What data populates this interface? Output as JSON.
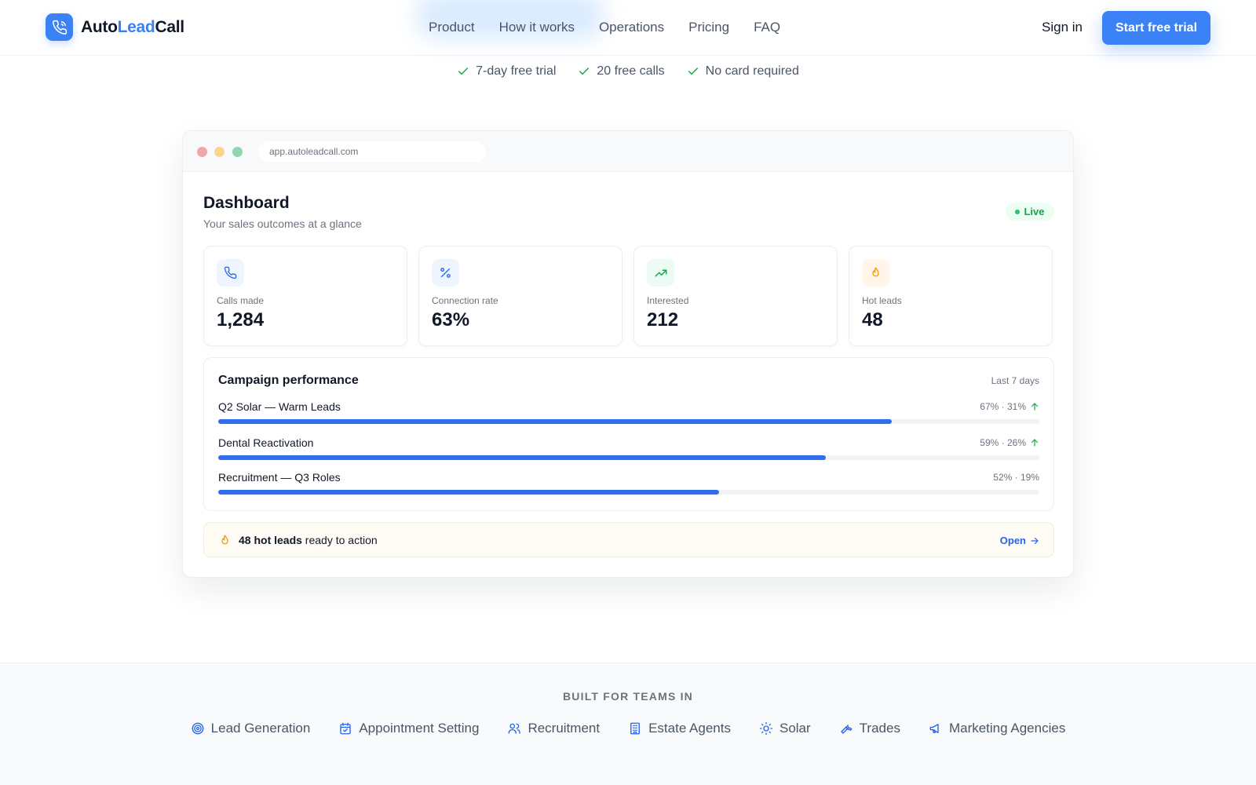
{
  "navbar": {
    "brand": {
      "prefix": "Auto",
      "accent": "Lead",
      "suffix": "Call",
      "icon": "phone-icon"
    },
    "links": [
      "Product",
      "How it works",
      "Operations",
      "Pricing",
      "FAQ"
    ],
    "signin_label": "Sign in",
    "cta_label": "Start free trial"
  },
  "trust": [
    "7-day free trial",
    "20 free calls",
    "No card required"
  ],
  "window": {
    "url": "app.autoleadcall.com"
  },
  "dashboard": {
    "title": "Dashboard",
    "subtitle": "Your sales outcomes at a glance",
    "live_label": "Live",
    "stats": [
      {
        "label": "Calls made",
        "value": "1,284",
        "icon": "phone-icon"
      },
      {
        "label": "Connection rate",
        "value": "63%",
        "icon": "percent-icon"
      },
      {
        "label": "Interested",
        "value": "212",
        "icon": "trending-up-icon"
      },
      {
        "label": "Hot leads",
        "value": "48",
        "icon": "flame-icon"
      }
    ],
    "campaigns": {
      "title": "Campaign performance",
      "range": "Last 7 days",
      "rows": [
        {
          "name": "Q2 Solar — Warm Leads",
          "stat": "67% · 31%",
          "trend": "up",
          "progress": 0.82
        },
        {
          "name": "Dental Reactivation",
          "stat": "59% · 26%",
          "trend": "up",
          "progress": 0.74
        },
        {
          "name": "Recruitment — Q3 Roles",
          "stat": "52% · 19%",
          "trend": "none",
          "progress": 0.61
        }
      ]
    },
    "hot_banner": {
      "bold": "48 hot leads",
      "rest": " ready to action",
      "action": "Open"
    }
  },
  "industries": {
    "title": "BUILT FOR TEAMS IN",
    "items": [
      {
        "label": "Lead Generation",
        "icon": "target-icon"
      },
      {
        "label": "Appointment Setting",
        "icon": "calendar-check-icon"
      },
      {
        "label": "Recruitment",
        "icon": "users-icon"
      },
      {
        "label": "Estate Agents",
        "icon": "building-icon"
      },
      {
        "label": "Solar",
        "icon": "sun-icon"
      },
      {
        "label": "Trades",
        "icon": "wrench-icon"
      },
      {
        "label": "Marketing Agencies",
        "icon": "megaphone-icon"
      }
    ]
  },
  "colors": {
    "accent": "#3b82f6",
    "bar": "#2f6fec",
    "live": "#16a34a",
    "hot": "#f59e0b"
  }
}
